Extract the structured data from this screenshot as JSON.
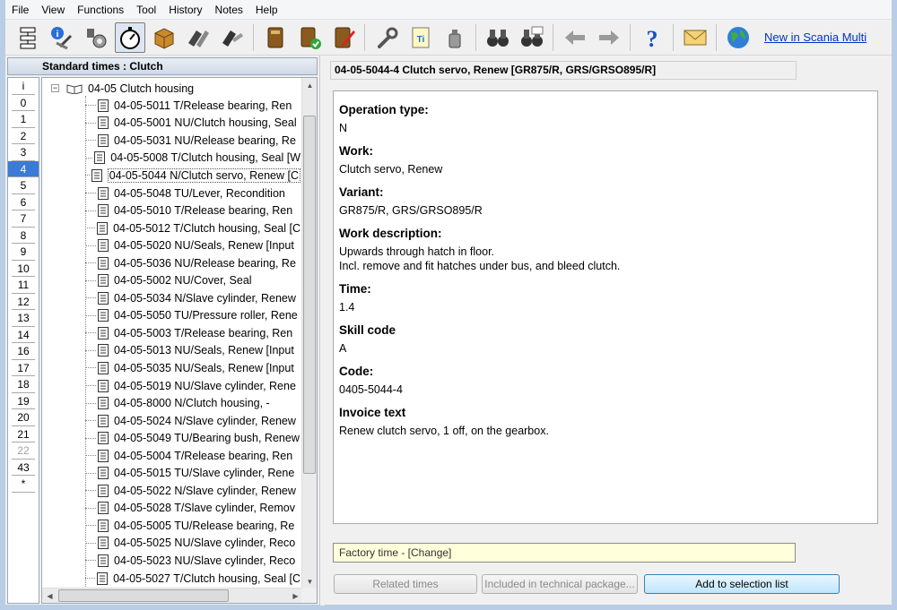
{
  "menu": [
    "File",
    "View",
    "Functions",
    "Tool",
    "History",
    "Notes",
    "Help"
  ],
  "toolbar": {
    "icons": [
      "flowchart-icon",
      "info-tools-icon",
      "engine-parts-icon",
      "stopwatch-icon",
      "package-icon",
      "hands-icon",
      "hands-wrench-icon",
      "book-icon",
      "book-check-icon",
      "notebook-pen-icon",
      "wrench-icon",
      "ti-document-icon",
      "oil-can-icon",
      "binoculars-icon",
      "binoculars-search-icon",
      "back-arrow-icon",
      "forward-arrow-icon",
      "help-icon",
      "mail-icon",
      "globe-icon"
    ],
    "link": "New in Scania Multi"
  },
  "left": {
    "header": "Standard times : Clutch",
    "index": [
      "i",
      "0",
      "1",
      "2",
      "3",
      "4",
      "5",
      "6",
      "7",
      "8",
      "9",
      "10",
      "11",
      "12",
      "13",
      "14",
      "16",
      "17",
      "18",
      "19",
      "20",
      "21",
      "22",
      "43",
      "*"
    ],
    "index_selected": "4",
    "index_disabled": "22",
    "tree_root": "04-05 Clutch housing",
    "tree_items": [
      "04-05-5011 T/Release bearing, Ren",
      "04-05-5001 NU/Clutch housing, Seal",
      "04-05-5031 NU/Release bearing, Re",
      "04-05-5008 T/Clutch housing, Seal [W",
      "04-05-5044 N/Clutch servo, Renew [C",
      "04-05-5048 TU/Lever, Recondition",
      "04-05-5010 T/Release bearing, Ren",
      "04-05-5012 T/Clutch housing, Seal [C",
      "04-05-5020 NU/Seals, Renew [Input",
      "04-05-5036 NU/Release bearing, Re",
      "04-05-5002 NU/Cover, Seal",
      "04-05-5034 N/Slave cylinder, Renew",
      "04-05-5050 TU/Pressure roller, Rene",
      "04-05-5003 T/Release bearing, Ren",
      "04-05-5013 NU/Seals, Renew [Input",
      "04-05-5035 NU/Seals, Renew [Input",
      "04-05-5019 NU/Slave cylinder, Rene",
      "04-05-8000 N/Clutch housing, -",
      "04-05-5024 N/Slave cylinder, Renew",
      "04-05-5049 TU/Bearing bush, Renew",
      "04-05-5004 T/Release bearing, Ren",
      "04-05-5015 TU/Slave cylinder, Rene",
      "04-05-5022 N/Slave cylinder, Renew",
      "04-05-5028 T/Slave cylinder, Remov",
      "04-05-5005 TU/Release bearing, Re",
      "04-05-5025 NU/Slave cylinder, Reco",
      "04-05-5023 NU/Slave cylinder, Reco",
      "04-05-5027 T/Clutch housing, Seal [C"
    ],
    "tree_selected_index": 4
  },
  "right": {
    "title": "04-05-5044-4 Clutch servo, Renew [GR875/R, GRS/GRSO895/R]",
    "fields": [
      {
        "label": "Operation type:",
        "value": [
          "N"
        ]
      },
      {
        "label": "Work:",
        "value": [
          "Clutch servo, Renew"
        ]
      },
      {
        "label": "Variant:",
        "value": [
          "GR875/R, GRS/GRSO895/R"
        ]
      },
      {
        "label": "Work description:",
        "value": [
          "Upwards through hatch in floor.",
          "Incl. remove and fit hatches under bus, and bleed clutch."
        ]
      },
      {
        "label": "Time:",
        "value": [
          "1.4"
        ]
      },
      {
        "label": "Skill code",
        "value": [
          "A"
        ]
      },
      {
        "label": "Code:",
        "value": [
          "0405-5044-4"
        ]
      },
      {
        "label": "Invoice text",
        "value": [
          "Renew clutch servo, 1 off, on the gearbox."
        ]
      }
    ],
    "factory_time": "Factory time - [Change]",
    "buttons": {
      "related": "Related times",
      "included": "Included in technical package...",
      "add": "Add to selection list"
    }
  }
}
